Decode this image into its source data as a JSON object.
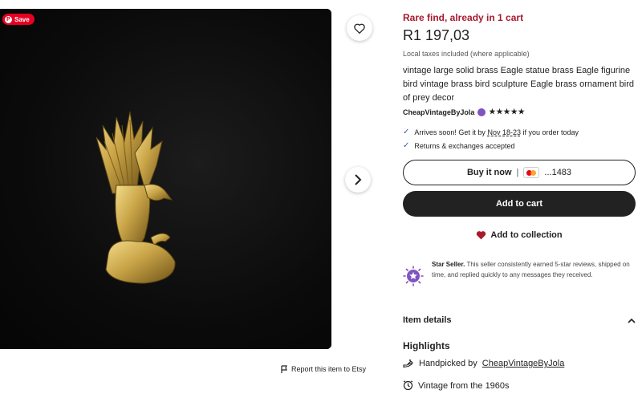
{
  "gallery": {
    "save_label": "Save",
    "report_label": "Report this item to Etsy"
  },
  "listing": {
    "scarcity": "Rare find, already in 1 cart",
    "price": "R1 197,03",
    "tax_note": "Local taxes included (where applicable)",
    "title": "vintage large solid brass Eagle statue brass Eagle figurine bird vintage brass bird sculpture Eagle brass ornament bird of prey decor",
    "shop_name": "CheapVintageByJola",
    "rating_stars": "★★★★★",
    "arrival_prefix": "Arrives soon! Get it by",
    "arrival_dates": "Nov 18-23",
    "arrival_suffix": "if you order today",
    "returns": "Returns & exchanges accepted"
  },
  "actions": {
    "buy_now": "Buy it now",
    "separator": "|",
    "card_last4": "...1483",
    "add_to_cart": "Add to cart",
    "add_to_collection": "Add to collection"
  },
  "star_seller": {
    "title": "Star Seller.",
    "description": "This seller consistently earned 5-star reviews, shipped on time, and replied quickly to any messages they received."
  },
  "details": {
    "item_details": "Item details",
    "highlights": "Highlights",
    "handpicked_prefix": "Handpicked by",
    "handpicked_shop": "CheapVintageByJola",
    "vintage": "Vintage from the 1960s"
  },
  "colors": {
    "scarcity": "#a61a2e",
    "cart_button": "#222222",
    "check": "#3d5fa5",
    "star_seller": "#7f53c1"
  },
  "icons": [
    "heart-icon",
    "chevron-right-icon",
    "flag-icon",
    "check-icon",
    "mastercard-icon",
    "heart-filled-icon",
    "star-seller-badge-icon",
    "chevron-up-icon",
    "hand-icon",
    "clock-icon"
  ]
}
